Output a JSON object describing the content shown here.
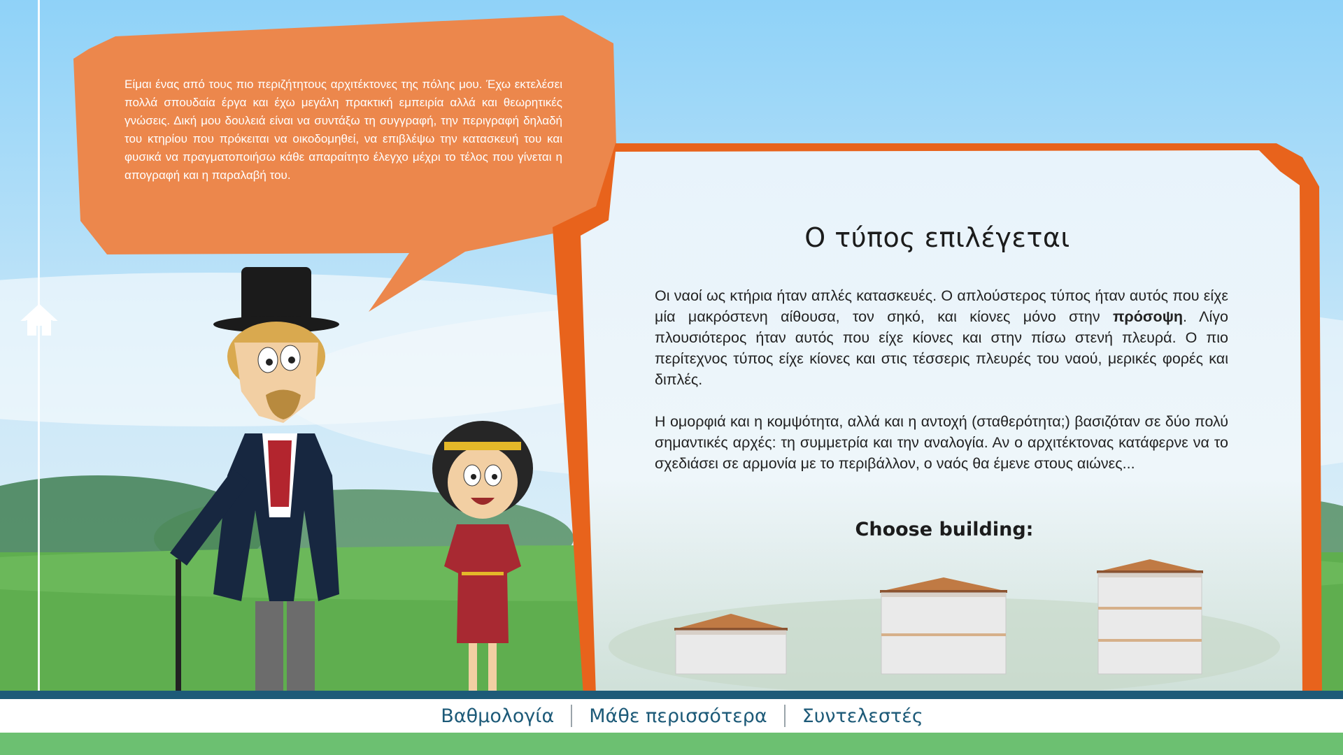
{
  "speech_bubble": {
    "text": "Είμαι ένας από τους πιο περιζήτητους αρχιτέκτονες της πόλης μου. Έχω εκτελέσει πολλά σπουδαία έργα και έχω μεγάλη πρακτική εμπειρία αλλά και θεωρητικές γνώσεις. Δική  μου δουλειά είναι να συντάξω τη συγγραφή, την περιγραφή δηλαδή του κτηρίου που πρόκειται να οικοδομηθεί, να επιβλέψω την κατασκευή του και φυσικά να πραγματοποιήσω κάθε απαραίτητο έλεγχο μέχρι το τέλος που γίνεται η απογραφή και η παραλαβή του."
  },
  "panel": {
    "title": "Ο τύπος επιλέγεται",
    "para1_before": "Οι ναοί ως κτήρια ήταν απλές κατασκευές. Ο απλούστερος τύπος ήταν αυτός που είχε μία μακρόστενη αίθουσα, τον σηκό, και κίονες μόνο στην ",
    "para1_bold": "πρόσοψη",
    "para1_after": ". Λίγο πλουσιότερος ήταν αυτός που είχε κίονες και στην πίσω στενή πλευρά. Ο πιο περίτεχνος τύπος είχε κίονες και στις τέσσερις πλευρές του ναού, μερικές φορές και διπλές.",
    "para2": "Η ομορφιά και η κομψότητα, αλλά και η αντοχή (σταθερότητα;) βασιζόταν σε δύο πολύ σημαντικές αρχές: τη συμμετρία και την αναλογία. Αν ο αρχιτέκτονας κατάφερνε να το σχεδιάσει σε αρμονία με το περιβάλλον, ο ναός θα έμενε στους αιώνες...",
    "choose_label": "Choose building:"
  },
  "buildings": [
    {
      "icon": "temple-small-icon",
      "tiers": 1
    },
    {
      "icon": "temple-medium-icon",
      "tiers": 2
    },
    {
      "icon": "temple-large-icon",
      "tiers": 3
    }
  ],
  "footer": {
    "links": [
      "Βαθμολογία",
      "Μάθε περισσότερα",
      "Συντελεστές"
    ]
  },
  "icons": {
    "home": "home-icon"
  },
  "colors": {
    "bubble": "#ec874c",
    "panel_border": "#e8631c",
    "footer_text": "#1d5a78",
    "sky_top": "#7dc6f0",
    "grass": "#5fae4f"
  }
}
